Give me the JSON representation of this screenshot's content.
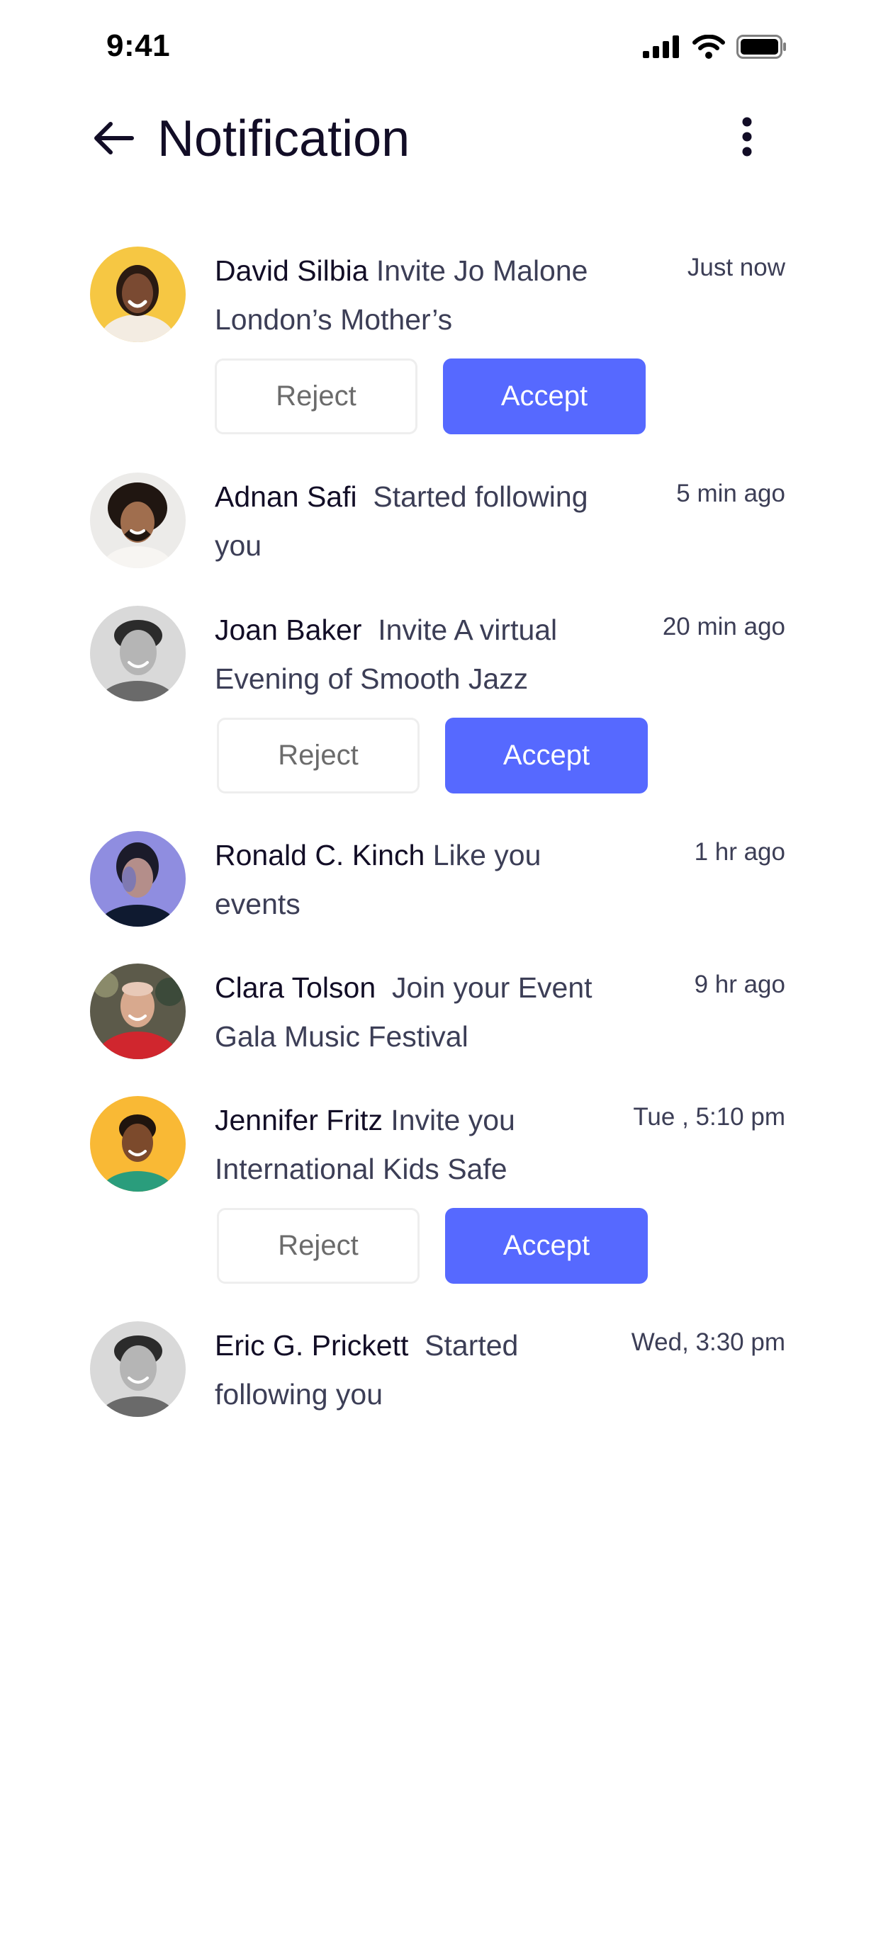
{
  "status_bar": {
    "time": "9:41",
    "icons": [
      "signal-icon",
      "wifi-icon",
      "battery-icon"
    ]
  },
  "header": {
    "title": "Notification",
    "back_icon": "arrow-left-icon",
    "menu_icon": "more-vertical-icon"
  },
  "colors": {
    "accent": "#5669ff",
    "title_text": "#120d26",
    "body_text": "#3c3e56",
    "reject_border": "#eeeeee"
  },
  "notifications": [
    {
      "name": "David Silbia",
      "message": "Invite Jo Malone London’s Mother’s",
      "time": "Just now",
      "reject_label": "Reject",
      "accept_label": "Accept"
    },
    {
      "name": "Adnan Safi",
      "message": "Started following you",
      "time": "5 min ago"
    },
    {
      "name": "Joan Baker",
      "message": "Invite A virtual Evening of Smooth Jazz",
      "time": "20 min ago",
      "reject_label": "Reject",
      "accept_label": "Accept"
    },
    {
      "name": "Ronald C. Kinch",
      "message": "Like you events",
      "time": "1 hr ago"
    },
    {
      "name": "Clara Tolson",
      "message": "Join your Event Gala Music Festival",
      "time": "9 hr ago"
    },
    {
      "name": "Jennifer Fritz",
      "message": "Invite you International Kids Safe",
      "time": "Tue , 5:10 pm",
      "reject_label": "Reject",
      "accept_label": "Accept"
    },
    {
      "name": "Eric G. Prickett",
      "message": "Started following you",
      "time": "Wed, 3:30 pm"
    }
  ]
}
